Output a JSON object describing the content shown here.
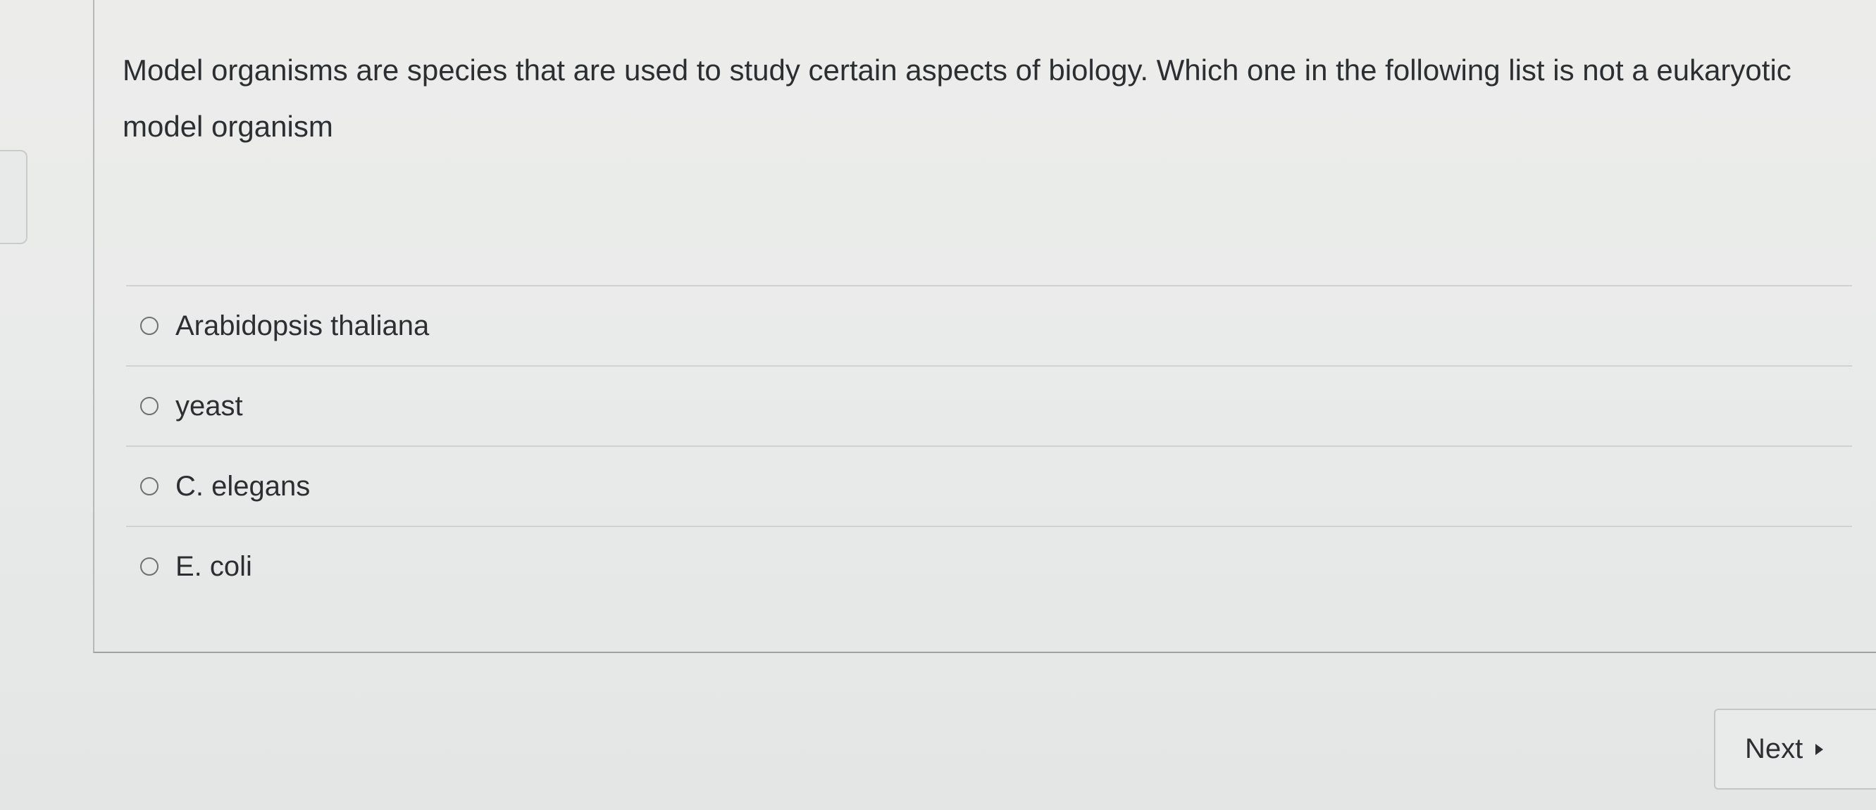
{
  "question": {
    "text": "Model organisms are species that are used to study certain aspects of biology. Which one in the following list is not a eukaryotic model organism"
  },
  "answers": [
    {
      "label": "Arabidopsis thaliana",
      "selected": false
    },
    {
      "label": "yeast",
      "selected": false
    },
    {
      "label": "C. elegans",
      "selected": false
    },
    {
      "label": "E. coli",
      "selected": false
    }
  ],
  "navigation": {
    "next_label": "Next",
    "next_icon": "caret-right-icon"
  }
}
